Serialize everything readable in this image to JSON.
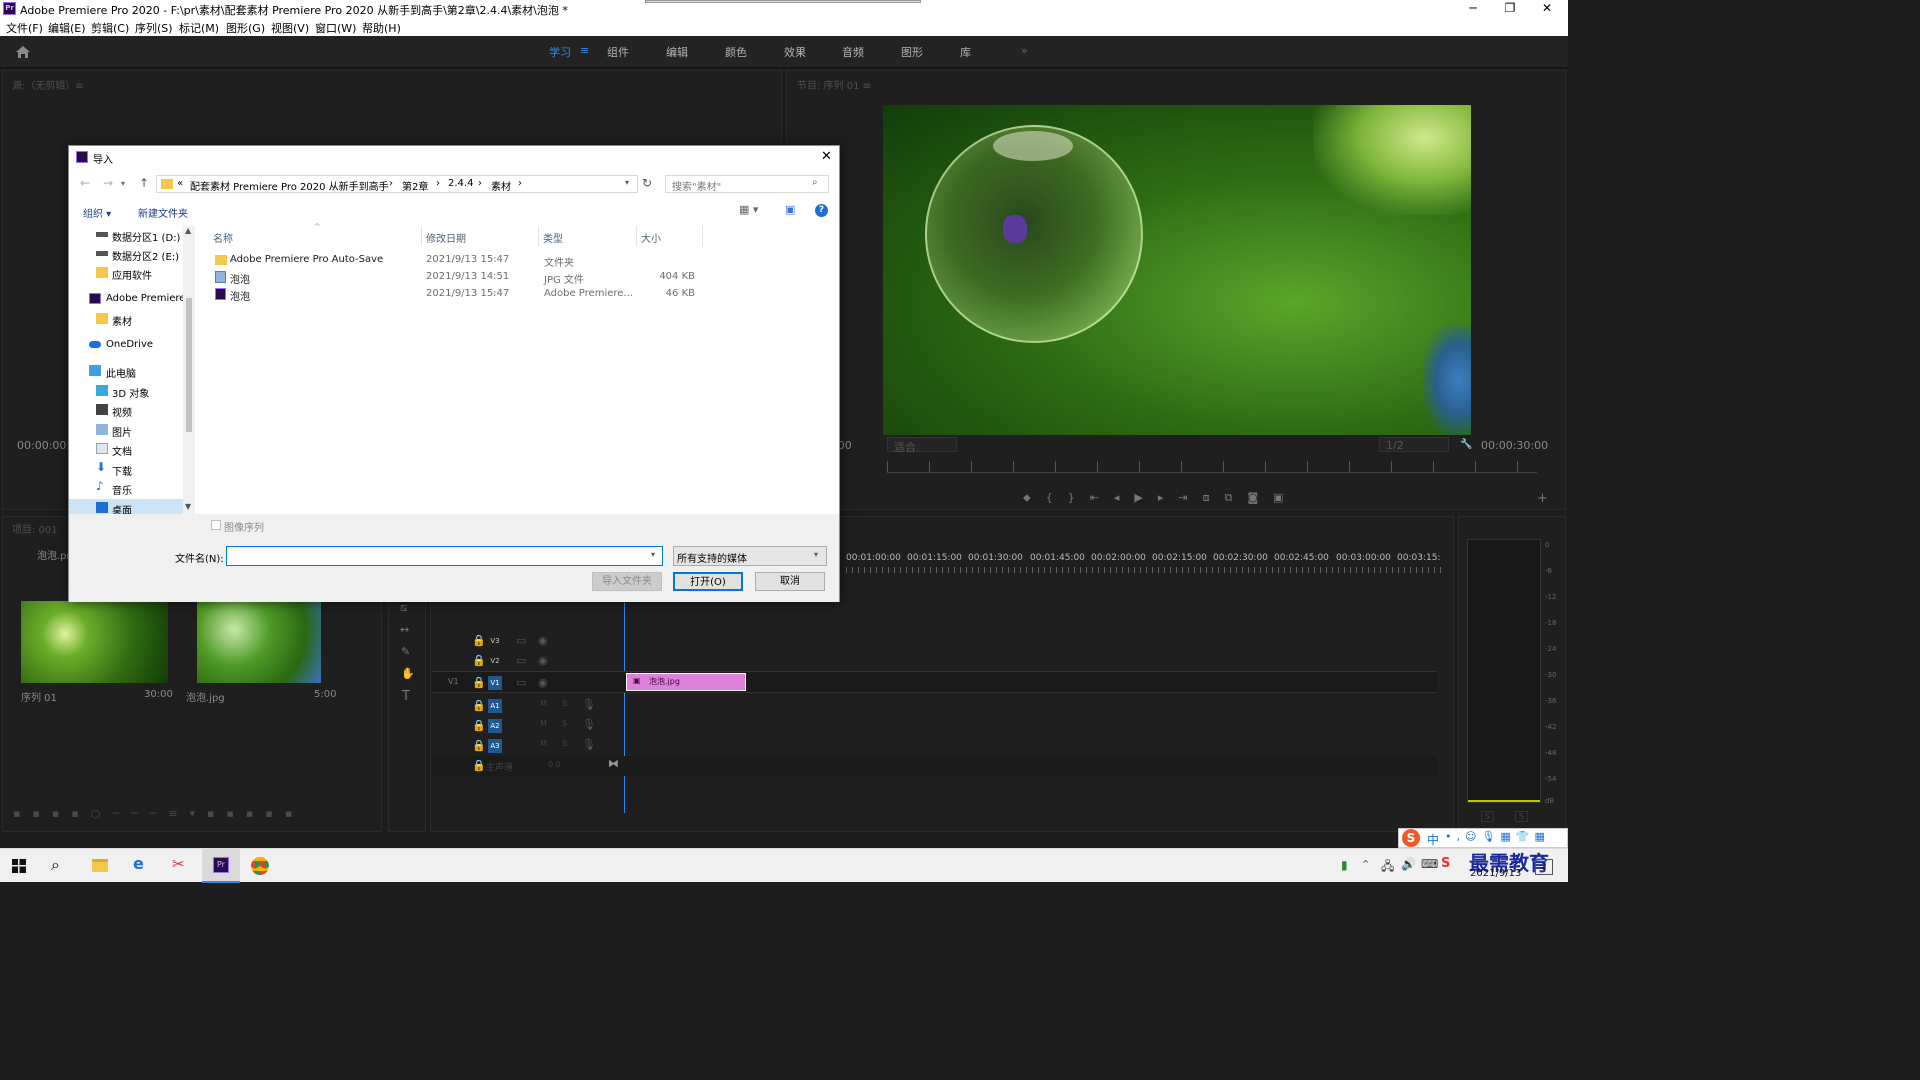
{
  "window": {
    "title": "Adobe Premiere Pro 2020 - F:\\pr\\素材\\配套素材 Premiere Pro 2020 从新手到高手\\第2章\\2.4.4\\素材\\泡泡 *",
    "logo": "Pr",
    "minimize": "─",
    "maximize": "❐",
    "close": "✕"
  },
  "menu": [
    "文件(F)",
    "编辑(E)",
    "剪辑(C)",
    "序列(S)",
    "标记(M)",
    "图形(G)",
    "视图(V)",
    "窗口(W)",
    "帮助(H)"
  ],
  "workspaces": {
    "active": "学习",
    "items": [
      "组件",
      "编辑",
      "颜色",
      "效果",
      "音频",
      "图形",
      "库"
    ],
    "more": "»"
  },
  "source_panel": {
    "title": "源:（无剪辑）≡",
    "timecode": "00:00:00:"
  },
  "program_panel": {
    "title": "节目: 序列 01 ≡",
    "timecode_left": "0:00",
    "fit": "适合",
    "resolution": "1/2",
    "timecode_right": "00:00:30:00"
  },
  "project_panel": {
    "title": "项目: 001",
    "file": "泡泡.pr",
    "items": [
      {
        "name": "序列 01",
        "duration": "30:00"
      },
      {
        "name": "泡泡.jpg",
        "duration": "5:00"
      }
    ]
  },
  "timeline": {
    "ruler": [
      "00:01:00:00",
      "00:01:15:00",
      "00:01:30:00",
      "00:01:45:00",
      "00:02:00:00",
      "00:02:15:00",
      "00:02:30:00",
      "00:02:45:00",
      "00:03:00:00",
      "00:03:15:"
    ],
    "video_tracks": [
      "V3",
      "V2",
      "V1"
    ],
    "audio_tracks": [
      "A1",
      "A2",
      "A3"
    ],
    "source_patch_v": "V1",
    "master": "主声道",
    "master_value": "0.0",
    "clip": "泡泡.jpg",
    "mute": "M",
    "solo": "S"
  },
  "meter": {
    "scale": [
      "0",
      "-6",
      "-12",
      "-18",
      "-24",
      "-30",
      "-36",
      "-42",
      "-48",
      "-54",
      "dB"
    ],
    "solo_buttons": [
      "S",
      "S"
    ]
  },
  "dialog": {
    "title": "导入",
    "path": [
      "«",
      "配套素材 Premiere Pro 2020 从新手到高手",
      "›",
      "第2章",
      "›",
      "2.4.4",
      "›",
      "素材",
      "›"
    ],
    "search_placeholder": "搜索\"素材\"",
    "organize": "组织 ▾",
    "new_folder": "新建文件夹",
    "help": "?",
    "nav": [
      {
        "label": "数据分区1 (D:)",
        "icon": "drive-icon"
      },
      {
        "label": "数据分区2 (E:)",
        "icon": "drive-icon"
      },
      {
        "label": "应用软件",
        "icon": "folder-icon"
      },
      {
        "label": "Adobe Premiere",
        "icon": "premiere-icon"
      },
      {
        "label": "素材",
        "icon": "folder-icon"
      },
      {
        "label": "OneDrive",
        "icon": "cloud-icon"
      },
      {
        "label": "此电脑",
        "icon": "pc-icon"
      },
      {
        "label": "3D 对象",
        "icon": "cube-icon"
      },
      {
        "label": "视频",
        "icon": "video-icon"
      },
      {
        "label": "图片",
        "icon": "pictures-icon"
      },
      {
        "label": "文档",
        "icon": "documents-icon"
      },
      {
        "label": "下载",
        "icon": "download-icon"
      },
      {
        "label": "音乐",
        "icon": "music-icon"
      },
      {
        "label": "桌面",
        "icon": "desktop-icon"
      }
    ],
    "columns": [
      "名称",
      "修改日期",
      "类型",
      "大小"
    ],
    "files": [
      {
        "name": "Adobe Premiere Pro Auto-Save",
        "date": "2021/9/13 15:47",
        "type": "文件夹",
        "size": "",
        "icon": "folder-icon"
      },
      {
        "name": "泡泡",
        "date": "2021/9/13 14:51",
        "type": "JPG 文件",
        "size": "404 KB",
        "icon": "image-file-icon"
      },
      {
        "name": "泡泡",
        "date": "2021/9/13 15:47",
        "type": "Adobe Premiere...",
        "size": "46 KB",
        "icon": "premiere-file-icon"
      }
    ],
    "image_sequence": "图像序列",
    "filename_label": "文件名(N):",
    "filename_value": "",
    "filetype": "所有支持的媒体",
    "import_folder": "导入文件夹",
    "open": "打开(O)",
    "cancel": "取消"
  },
  "taskbar": {
    "time": "",
    "date": "2021/9/13",
    "ime": "中",
    "watermark": "最需教育",
    "notification": "2"
  },
  "colors": {
    "accent": "#2d8ceb",
    "clip": "#e07fdc",
    "track_active": "#1e5a90"
  }
}
